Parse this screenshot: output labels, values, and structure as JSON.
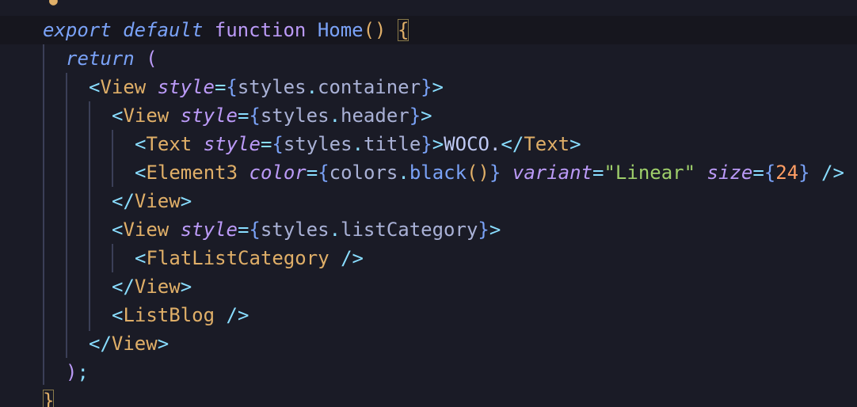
{
  "editor": {
    "lines": [
      {
        "tokens": [
          "export",
          "default",
          "function",
          "Home",
          "()",
          "{"
        ]
      },
      {
        "tokens": [
          "return",
          "("
        ]
      },
      {
        "tokens": [
          "<",
          "View",
          "style",
          "=",
          "{",
          "styles",
          ".",
          "container",
          "}",
          ">"
        ]
      },
      {
        "tokens": [
          "<",
          "View",
          "style",
          "=",
          "{",
          "styles",
          ".",
          "header",
          "}",
          ">"
        ]
      },
      {
        "tokens": [
          "<",
          "Text",
          "style",
          "=",
          "{",
          "styles",
          ".",
          "title",
          "}",
          ">",
          "WOCO.",
          "</",
          "Text",
          ">"
        ]
      },
      {
        "tokens": [
          "<",
          "Element3",
          "color",
          "=",
          "{",
          "colors",
          ".",
          "black",
          "()",
          "}",
          "variant",
          "=",
          "\"Linear\"",
          "size",
          "=",
          "{",
          "24",
          "}",
          "/>"
        ]
      },
      {
        "tokens": [
          "</",
          "View",
          ">"
        ]
      },
      {
        "tokens": [
          "<",
          "View",
          "style",
          "=",
          "{",
          "styles",
          ".",
          "listCategory",
          "}",
          ">"
        ]
      },
      {
        "tokens": [
          "<",
          "FlatListCategory",
          "/>"
        ]
      },
      {
        "tokens": [
          "</",
          "View",
          ">"
        ]
      },
      {
        "tokens": [
          "<",
          "ListBlog",
          "/>"
        ]
      },
      {
        "tokens": [
          "</",
          "View",
          ">"
        ]
      },
      {
        "tokens": [
          ")",
          ";"
        ]
      },
      {
        "tokens": [
          "}"
        ]
      }
    ]
  },
  "colors": {
    "background": "#1a1b26",
    "keyword": "#bb9af7",
    "function": "#7aa2f7",
    "tag": "#e0af68",
    "string": "#9ece6a",
    "number": "#ff9e64",
    "property": "#7dcfff",
    "punctuation": "#89ddff"
  },
  "icons": {
    "lightbulb": "lightbulb-icon"
  }
}
